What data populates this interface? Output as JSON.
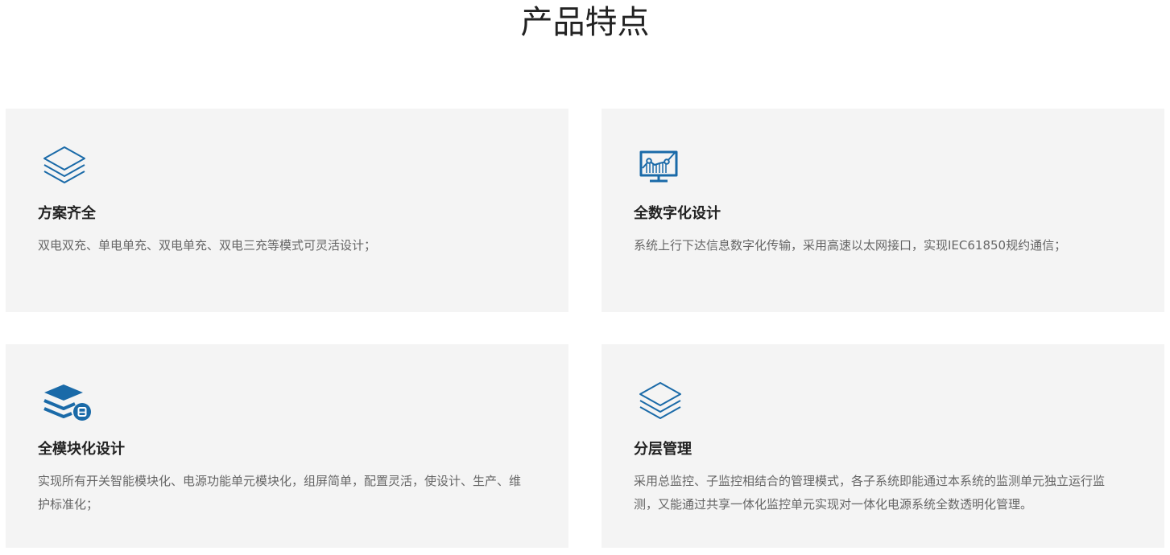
{
  "section": {
    "title": "产品特点"
  },
  "features": [
    {
      "icon": "layers-stack-icon",
      "title": "方案齐全",
      "description": "双电双充、单电单充、双电单充、双电三充等模式可灵活设计；"
    },
    {
      "icon": "monitor-chart-icon",
      "title": "全数字化设计",
      "description": "系统上行下达信息数字化传输，采用高速以太网接口，实现IEC61850规约通信；"
    },
    {
      "icon": "module-stack-icon",
      "title": "全模块化设计",
      "description": "实现所有开关智能模块化、电源功能单元模块化，组屏简单，配置灵活，使设计、生产、维护标准化；"
    },
    {
      "icon": "layers-stack-icon",
      "title": "分层管理",
      "description": "采用总监控、子监控相结合的管理模式，各子系统即能通过本系统的监测单元独立运行监测，又能通过共享一体化监控单元实现对一体化电源系统全数透明化管理。"
    }
  ],
  "colors": {
    "accent": "#1a6aa8",
    "card_background": "#f4f4f4",
    "title_text": "#222222",
    "body_text": "#666666"
  }
}
